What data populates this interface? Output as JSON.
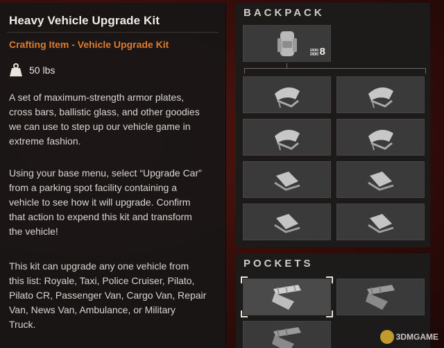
{
  "item": {
    "title": "Heavy Vehicle Upgrade Kit",
    "subtitle": "Crafting Item - Vehicle Upgrade Kit",
    "weight": "50 lbs",
    "description": [
      [
        "A set of maximum-strength armor plates,",
        "cross bars, ballistic glass, and other goodies",
        "we can use to step up our vehicle game in",
        "extreme fashion."
      ],
      [
        "Using your base menu, select “Upgrade Car”",
        "from a parking spot facility containing a",
        "vehicle to see how it will upgrade. Confirm",
        "that action to expend this kit and transform",
        "the vehicle!"
      ],
      [
        "This kit can upgrade any one vehicle from",
        "this list: Royale, Taxi, Police Cruiser, Pilato,",
        "Pilato CR, Passenger Van, Cargo Van, Repair",
        "Van, News Van, Ambulance, or Military",
        "Truck."
      ]
    ]
  },
  "backpack": {
    "title": "BACKPACK",
    "bag_count": "8",
    "slots": [
      "armor-kit",
      "armor-kit",
      "armor-kit",
      "armor-kit",
      "plate-kit",
      "plate-kit",
      "plate-kit",
      "plate-kit"
    ]
  },
  "pockets": {
    "title": "POCKETS",
    "slots": [
      "heavy-kit",
      "heavy-kit",
      "heavy-kit"
    ]
  },
  "watermark": "3DMGAME",
  "colors": {
    "accent": "#e07a2b",
    "panel": "#1c1b1b",
    "slot": "#3a3a3a"
  }
}
